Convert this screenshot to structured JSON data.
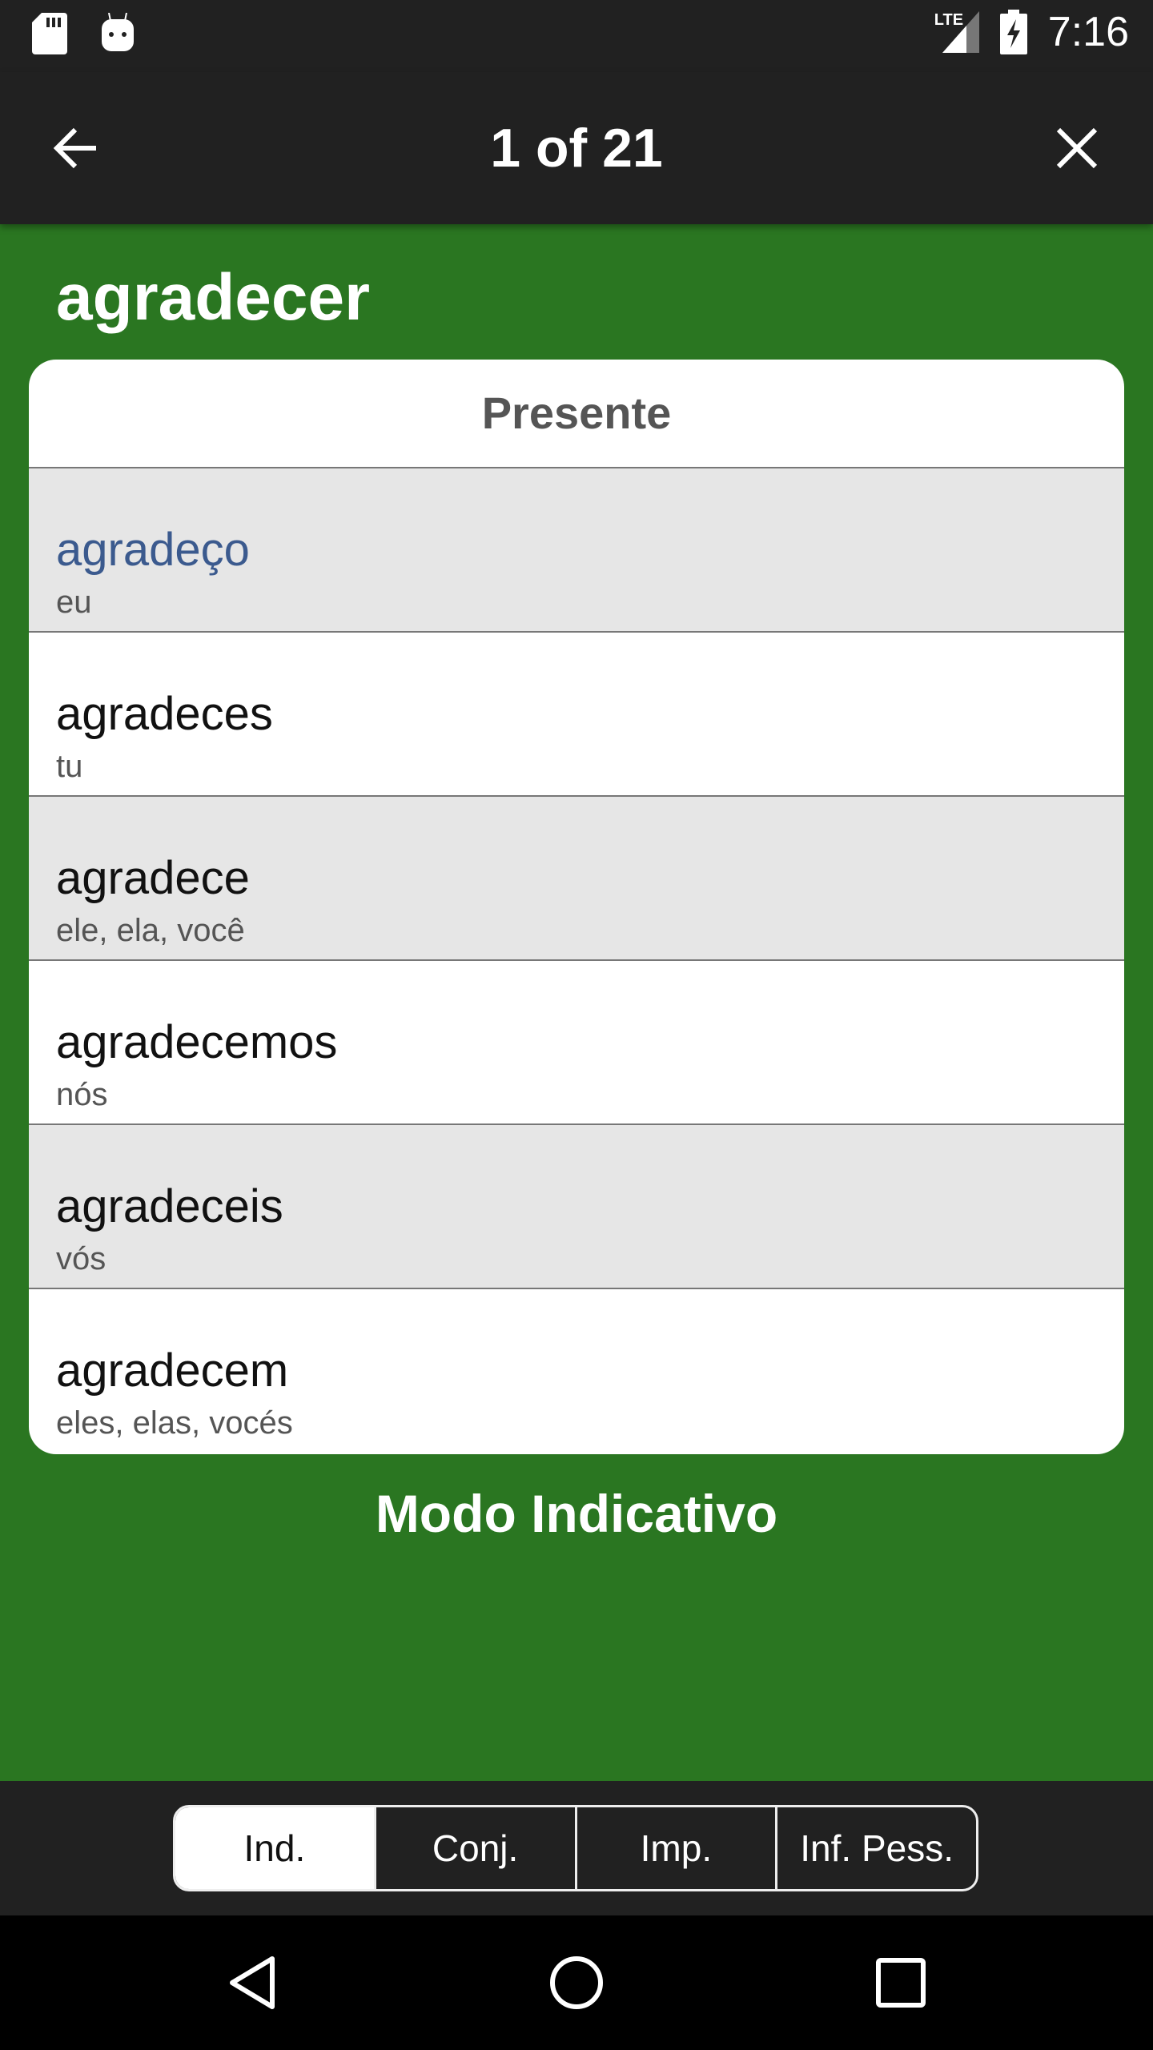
{
  "status_bar": {
    "time": "7:16",
    "network": "LTE",
    "icons": [
      "sd-card-icon",
      "android-debug-icon",
      "signal-icon",
      "battery-charging-icon"
    ]
  },
  "toolbar": {
    "title": "1 of 21",
    "back_icon": "arrow-left-icon",
    "close_icon": "close-icon"
  },
  "verb": "agradecer",
  "card": {
    "tense": "Presente",
    "rows": [
      {
        "form": "agradeço",
        "pronoun": "eu"
      },
      {
        "form": "agradeces",
        "pronoun": "tu"
      },
      {
        "form": "agradece",
        "pronoun": "ele, ela, você"
      },
      {
        "form": "agradecemos",
        "pronoun": "nós"
      },
      {
        "form": "agradeceis",
        "pronoun": "vós"
      },
      {
        "form": "agradecem",
        "pronoun": "eles, elas, vocés"
      }
    ]
  },
  "mode": "Modo Indicativo",
  "tabs": [
    {
      "label": "Ind.",
      "active": true
    },
    {
      "label": "Conj."
    },
    {
      "label": "Imp."
    },
    {
      "label": "Inf. Pess."
    }
  ],
  "colors": {
    "background": "#2a7621",
    "bar": "#212121",
    "highlight": "#3b5a8e"
  }
}
